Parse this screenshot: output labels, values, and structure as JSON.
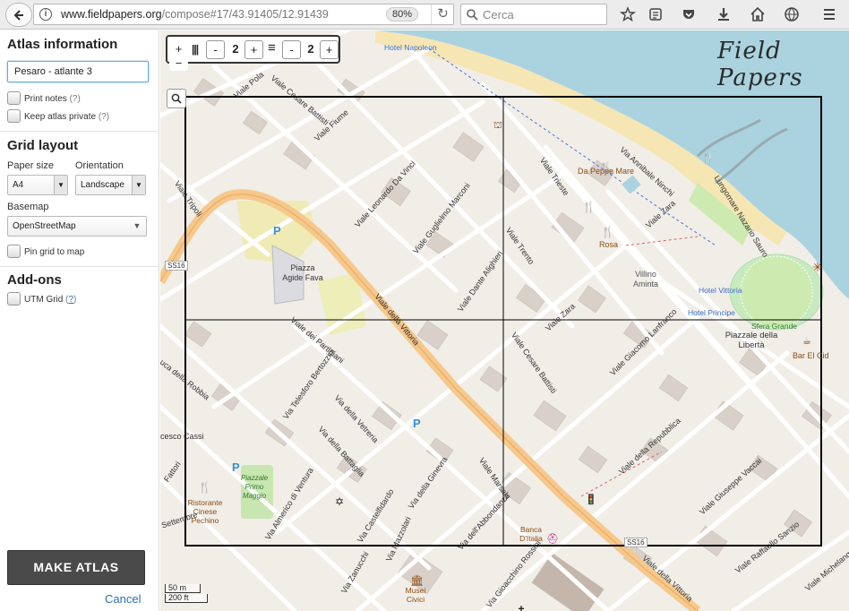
{
  "browser": {
    "url_host": "www.fieldpapers.org",
    "url_path": "/compose#17/43.91405/12.91439",
    "zoom": "80%",
    "search_placeholder": "Cerca"
  },
  "sidebar": {
    "atlas_info_title": "Atlas information",
    "atlas_title_value": "Pesaro - atlante 3",
    "print_notes_label": "Print notes",
    "print_notes_help": "(?)",
    "keep_private_label": "Keep atlas private",
    "keep_private_help": "(?)",
    "grid_layout_title": "Grid layout",
    "paper_size_label": "Paper size",
    "paper_size_value": "A4",
    "orientation_label": "Orientation",
    "orientation_value": "Landscape",
    "basemap_label": "Basemap",
    "basemap_value": "OpenStreetMap",
    "pin_grid_label": "Pin grid to map",
    "addons_title": "Add-ons",
    "utm_grid_label": "UTM Grid",
    "utm_grid_help": "?",
    "make_atlas_label": "MAKE ATLAS",
    "cancel_label": "Cancel"
  },
  "map_controls": {
    "zoom_in": "+",
    "zoom_out": "−",
    "cols_minus": "-",
    "cols_value": "2",
    "cols_plus": "+",
    "rows_minus": "-",
    "rows_value": "2",
    "rows_plus": "+"
  },
  "logo_text": "Field Papers",
  "scale": {
    "metric": "50 m",
    "imperial": "200 ft"
  },
  "map_labels": {
    "hotel_napoleon": "Hotel Napoleon",
    "viale_fiume": "Viale Fiume",
    "viale_pola": "Viale Pola",
    "viale_cesare_battisti_top": "Viale Cesare Battisti",
    "viale_tripoli": "Viale Tripoli",
    "ss16_left": "SS16",
    "viale_leonardo_da_vinci": "Viale Leonardo Da Vinci",
    "viale_guglielmo_marconi": "Viale Guglielmo Marconi",
    "viale_dante_alighieri": "Viale Dante Alighieri",
    "viale_trento": "Viale Trento",
    "viale_trieste": "Viale Trieste",
    "da_peppe_mare": "Da Peppe Mare",
    "via_annibale_ninchi": "Via Annibale Ninchi",
    "lungomare": "Lungomare Nazario Sauro",
    "viale_zara_top": "Viale Zara",
    "rosa": "Rosa",
    "villino_aminta": "Villino Aminta",
    "hotel_vittoria": "Hotel Vittoria",
    "hotel_principe": "Hotel Principe",
    "sfera_grande": "Sfera Grande",
    "piazzale_liberta": "Piazzale della Libertà",
    "bar_el_cid": "Bar El Cid",
    "piazza_agide_fava": "Piazza Agide Fava",
    "viale_della_vittoria": "Viale della Vittoria",
    "viale_dei_partigiani": "Viale dei Partigiani",
    "luca_della_robbia": "Luca della Robbia",
    "via_telesforo_bertozzini": "Via Telesforo Bertozzini",
    "via_della_vetreria": "Via della Vetreria",
    "via_della_battaglia": "Via della Battaglia",
    "cesco_cassi": "cesco Cassi",
    "fattori": "Fattori",
    "ristorante_cinese": "Ristorante Cinese Pechino",
    "piazzale_primo_maggio": "Piazzale Primo Maggio",
    "settembre": "Settembre",
    "via_almerico_da_ventura": "Via Almerico di Ventura",
    "via_castelfidardo": "Via Castelfidardo",
    "via_ginevra": "Via della Ginevra",
    "via_abbondanza": "Via dell'Abbondanza",
    "via_mazzolari": "Via Mazzolari",
    "via_zanucchi": "Via Zanucchi",
    "viale_marsala": "Viale Marsala",
    "viale_cesare_battisti_mid": "Viale Cesare Battisti",
    "viale_zara_mid": "Viale Zara",
    "viale_giacomo_lanfranco": "Viale Giacomo Lanfranco",
    "viale_della_repubblica": "Viale della Repubblica",
    "viale_giuseppe_vaccai": "Viale Giuseppe Vaccai",
    "viale_raffaello_sanzio": "Viale Raffaello Sanzio",
    "viale_michelangelo": "Viale Michelangelo",
    "banca_ditalia": "Banca D'Italia",
    "ss16_bottom": "SS16",
    "viale_della_vittoria_bottom": "Viale della Vittoria",
    "via_gioacchino_rossini": "Via Gioacchino Rossini",
    "musei_civici": "Musei Civici",
    "parking": "P"
  }
}
